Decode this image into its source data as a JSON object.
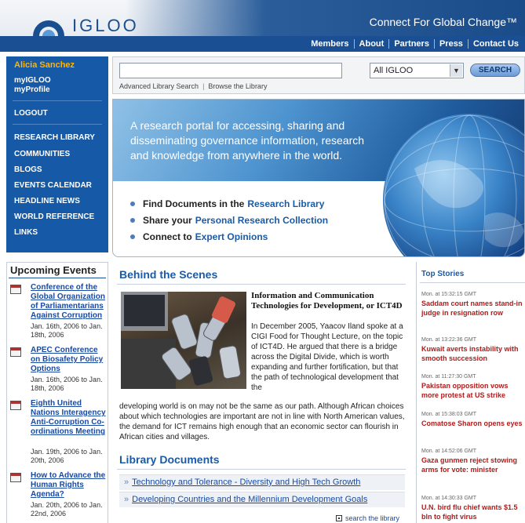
{
  "header": {
    "logo_text": "IGLOO",
    "tagline": "Connect For Global Change™",
    "nav": [
      "Members",
      "About",
      "Partners",
      "Press",
      "Contact Us"
    ]
  },
  "sidebar": {
    "user_name": "Alicia Sanchez",
    "account_links": [
      "myIGLOO",
      "myProfile"
    ],
    "logout": "LOGOUT",
    "nav": [
      "RESEARCH LIBRARY",
      "COMMUNITIES",
      "BLOGS",
      "EVENTS CALENDAR",
      "HEADLINE NEWS",
      "WORLD REFERENCE",
      "LINKS"
    ]
  },
  "search": {
    "value": "",
    "scope": "All IGLOO",
    "button": "SEARCH",
    "links": [
      "Advanced Library Search",
      "Browse the Library"
    ]
  },
  "hero": {
    "text": "A research portal for accessing, sharing and disseminating governance information, research and knowledge from anywhere in the world.",
    "items": [
      {
        "prefix": "Find Documents in the",
        "link": "Research Library"
      },
      {
        "prefix": "Share your",
        "link": "Personal Research Collection"
      },
      {
        "prefix": "Connect to",
        "link": "Expert Opinions"
      }
    ]
  },
  "events": {
    "title": "Upcoming Events",
    "items": [
      {
        "title": "Conference of the Global Organization of Parliamentarians Against Corruption",
        "date": "Jan. 16th, 2006 to Jan. 18th, 2006"
      },
      {
        "title": "APEC Conference on Biosafety Policy Options",
        "date": "Jan. 16th, 2006 to Jan. 18th, 2006"
      },
      {
        "title": "Eighth United Nations Interagency Anti-Corruption Co-ordinations Meeting",
        "date": "Jan. 19th, 2006 to Jan. 20th, 2006"
      },
      {
        "title": "How to Advance the Human Rights Agenda?",
        "date": "Jan. 20th, 2006 to Jan. 22nd, 2006"
      }
    ]
  },
  "behind_scenes": {
    "title": "Behind the Scenes",
    "headline": "Information and Communication Technologies for Development, or ICT4D",
    "body_right": "In December 2005, Yaacov Iland spoke at a CIGI Food for Thought Lecture, on the topic of ICT4D. He argued that there is a bridge across the Digital Divide, which is worth expanding and further fortification, but that the path of technological development that the",
    "body_full": "developing world is on may not be the same as our path. Although African choices about which technologies are important are not in line with North American values, the demand for ICT remains high enough that an economic sector can flourish in African cities and villages."
  },
  "library": {
    "title": "Library Documents",
    "items": [
      "Technology and Tolerance - Diversity and High Tech Growth",
      "Developing Countries and the Millennium Development Goals"
    ],
    "search_link": "search the library"
  },
  "top_stories": {
    "title": "Top Stories",
    "items": [
      {
        "time": "Mon. at 15:32:15 GMT",
        "title": "Saddam court names stand-in judge in resignation row"
      },
      {
        "time": "Mon. at 13:22:36 GMT",
        "title": "Kuwait averts instability with smooth succession"
      },
      {
        "time": "Mon. at 11:27:30 GMT",
        "title": "Pakistan opposition vows more protest at US strike"
      },
      {
        "time": "Mon. at 15:38:03 GMT",
        "title": "Comatose Sharon opens eyes"
      },
      {
        "time": "Mon. at 14:52:06 GMT",
        "title": "Gaza gunmen reject stowing arms for vote: minister"
      },
      {
        "time": "Mon. at 14:30:33 GMT",
        "title": "U.N. bird flu chief wants $1.5 bln to fight virus"
      }
    ]
  },
  "colors": {
    "brand_blue": "#1659a6",
    "link_blue": "#1a5aa6",
    "user_name_orange": "#ffb400",
    "story_red": "#b01c1c"
  }
}
